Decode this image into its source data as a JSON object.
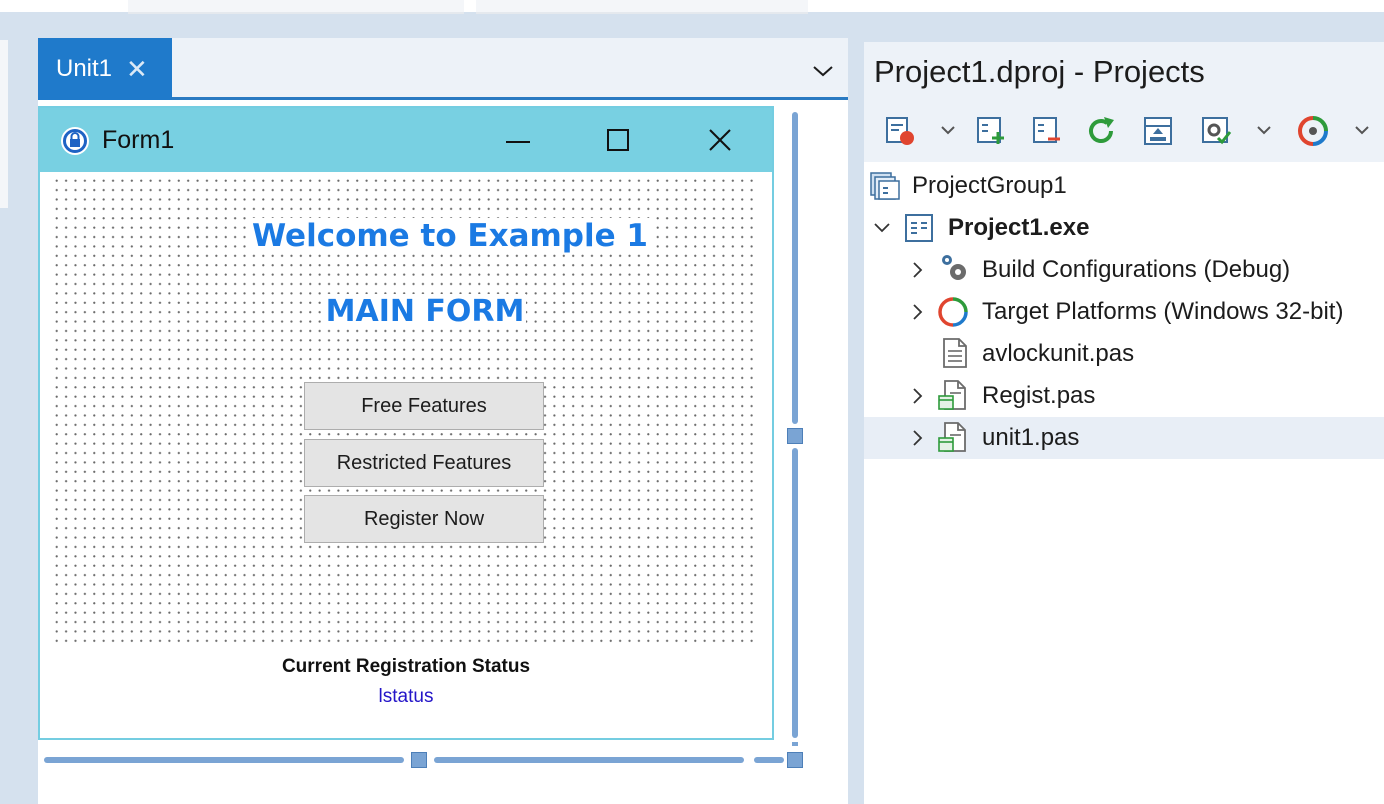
{
  "editor": {
    "tab_label": "Unit1",
    "tab_close": "✕"
  },
  "form": {
    "caption": "Form1",
    "heading": "Welcome to Example 1",
    "subheading": "MAIN FORM",
    "buttons": [
      {
        "label": "Free Features"
      },
      {
        "label": "Restricted Features"
      },
      {
        "label": "Register Now"
      }
    ],
    "status_label": "Current Registration Status",
    "status_value": "lstatus"
  },
  "projects": {
    "title": "Project1.dproj - Projects",
    "toolbar_icons": [
      "new-item-icon",
      "add-icon",
      "remove-icon",
      "refresh-icon",
      "sync-icon",
      "build-icon",
      "target-icon"
    ],
    "tree": [
      {
        "label": "ProjectGroup1",
        "icon": "project-group-icon",
        "level": 0,
        "expander": "none"
      },
      {
        "label": "Project1.exe",
        "icon": "exe-project-icon",
        "level": 1,
        "expander": "expanded",
        "bold": true
      },
      {
        "label": "Build Configurations (Debug)",
        "icon": "gears-icon",
        "level": 2,
        "expander": "collapsed"
      },
      {
        "label": "Target Platforms (Windows 32-bit)",
        "icon": "target-platform-icon",
        "level": 2,
        "expander": "collapsed"
      },
      {
        "label": "avlockunit.pas",
        "icon": "pas-file-icon",
        "level": 2,
        "expander": "none"
      },
      {
        "label": "Regist.pas",
        "icon": "form-unit-icon",
        "level": 2,
        "expander": "collapsed"
      },
      {
        "label": "unit1.pas",
        "icon": "form-unit-icon",
        "level": 2,
        "expander": "collapsed",
        "selected": true
      }
    ]
  },
  "colors": {
    "accent": "#1f7acb",
    "form_title_bar": "#78d0e2",
    "heading": "#1b7ae3",
    "status_value": "#2314c8"
  }
}
